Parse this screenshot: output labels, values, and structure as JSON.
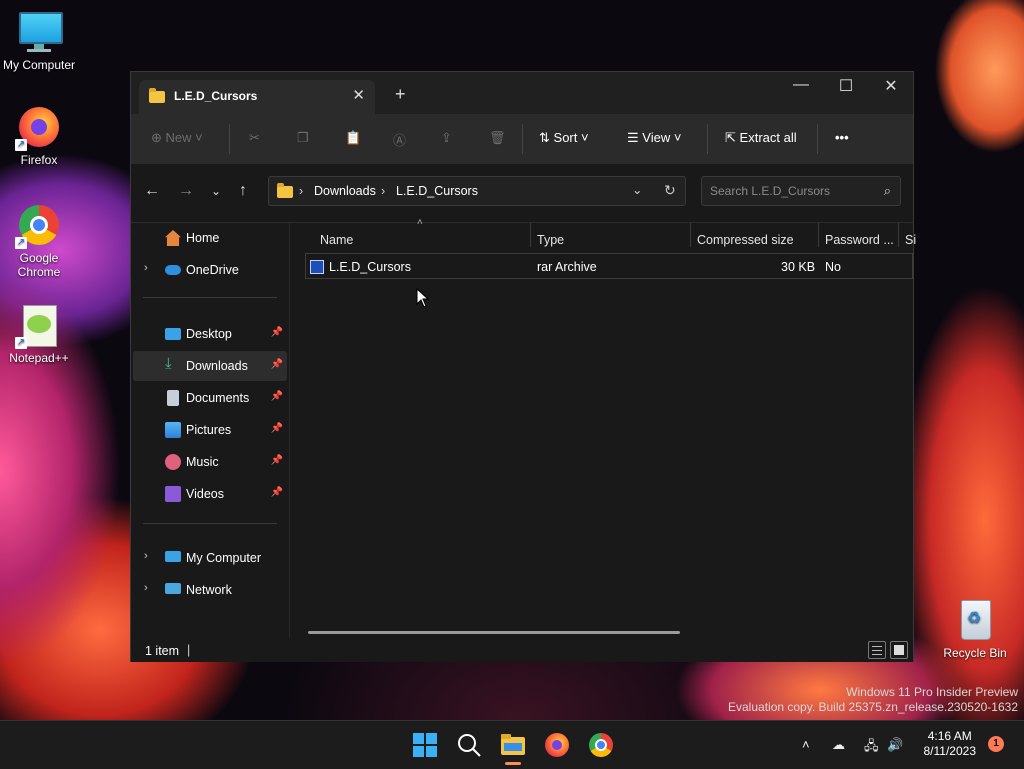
{
  "desktop": {
    "icons": [
      {
        "label": "My Computer"
      },
      {
        "label": "Firefox"
      },
      {
        "label": "Google Chrome"
      },
      {
        "label": "Notepad++"
      },
      {
        "label": "Recycle Bin"
      }
    ],
    "watermark": {
      "line1": "Windows 11 Pro Insider Preview",
      "line2": "Evaluation copy. Build 25375.zn_release.230520-1632"
    }
  },
  "explorer": {
    "tab_title": "L.E.D_Cursors",
    "new_tab": "+",
    "window_controls": {
      "minimize": "—",
      "maximize": "☐",
      "close": "✕"
    },
    "toolbar": {
      "new_label": "New",
      "sort_label": "Sort",
      "view_label": "View",
      "extract_label": "Extract all",
      "more_label": "•••"
    },
    "breadcrumb": {
      "part1": "Downloads",
      "part2": "L.E.D_Cursors",
      "sep": "›"
    },
    "search_placeholder": "Search L.E.D_Cursors",
    "sidebar": {
      "home": "Home",
      "onedrive": "OneDrive",
      "desktop": "Desktop",
      "downloads": "Downloads",
      "documents": "Documents",
      "pictures": "Pictures",
      "music": "Music",
      "videos": "Videos",
      "mycomputer": "My Computer",
      "network": "Network"
    },
    "columns": {
      "name": "Name",
      "type": "Type",
      "compressed": "Compressed size",
      "password": "Password ...",
      "size": "Si"
    },
    "files": [
      {
        "name": "L.E.D_Cursors",
        "type": "rar Archive",
        "compressed": "30 KB",
        "password": "No"
      }
    ],
    "status": {
      "count": "1 item"
    }
  },
  "taskbar": {
    "time": "4:16 AM",
    "date": "8/11/2023",
    "notification_count": "1"
  }
}
